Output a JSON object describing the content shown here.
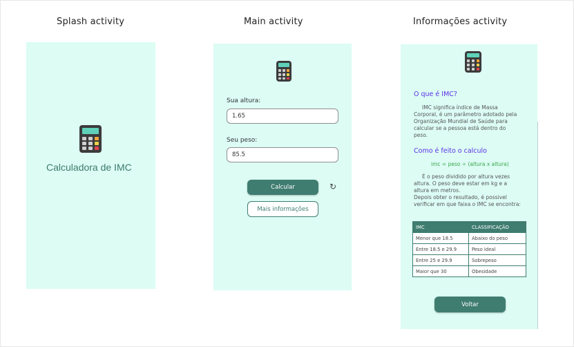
{
  "captions": {
    "splash": "Splash activity",
    "main": "Main activity",
    "info": "Informações activity"
  },
  "splash": {
    "title": "Calculadora de IMC"
  },
  "main": {
    "height_label": "Sua altura:",
    "height_value": "1.65",
    "weight_label": "Seu peso:",
    "weight_value": "85.5",
    "calc_button": "Calcular",
    "refresh_icon": "↻",
    "more_button": "Mais informações"
  },
  "info": {
    "what_heading": "O que é IMC?",
    "what_lines": [
      "IMC significa índice de Massa",
      "Corporal, é um parâmetro adotado pela",
      "Organização Mundial de Saúde para",
      "calcular  se a pessoa está dentro do",
      "peso."
    ],
    "how_heading": "Como é feito o calculo",
    "formula": "imc = peso ÷ (altura x altura)",
    "how_lines": [
      "É o peso dividido por altura vezes",
      "altura. O peso deve estar em kg e a",
      "altura em metros.",
      "Depois obter o  resultado, é possivel",
      "verificar em que faixa o IMC se encontra:"
    ],
    "table": {
      "headers": [
        "IMC",
        "CLASSIFICAÇÃO"
      ],
      "rows": [
        [
          "Menor que 18.5",
          "Abaixo do peso"
        ],
        [
          "Entre 18.5 e 29.9",
          "Peso ideal"
        ],
        [
          "Entre 25 e 29.9",
          "Sobrepeso"
        ],
        [
          "Maior que 30",
          "Obesidade"
        ]
      ]
    },
    "back_button": "Voltar"
  },
  "colors": {
    "screen_bg": "#dcfcf4",
    "accent": "#3f7d70",
    "heading": "#5b2fe6",
    "formula": "#3aa64a"
  },
  "icons": [
    "calculator-icon",
    "refresh-icon"
  ]
}
